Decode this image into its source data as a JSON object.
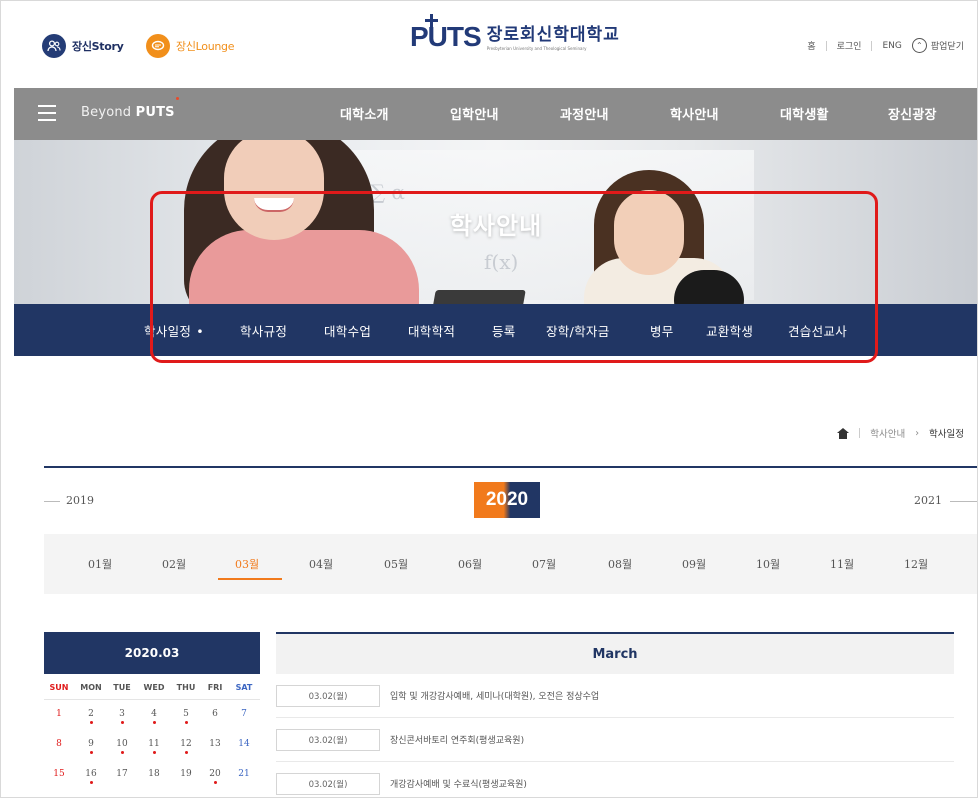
{
  "header": {
    "story_label": "장신Story",
    "lounge_label": "장신Lounge",
    "logo_mark": "PUTS",
    "logo_name": "장로회신학대학교",
    "logo_sub": "Presbyterian University and Theological Seminary",
    "util": {
      "home": "홈",
      "login": "로그인",
      "eng": "ENG",
      "popup_close": "팝업닫기"
    }
  },
  "gnb": {
    "beyond_prefix": "Beyond",
    "beyond_brand": "PUTS",
    "menus": [
      "대학소개",
      "입학안내",
      "과정안내",
      "학사안내",
      "대학생활",
      "장신광장"
    ]
  },
  "banner": {
    "title": "학사안내"
  },
  "lnb": {
    "items": [
      "학사일정",
      "학사규정",
      "대학수업",
      "대학학적",
      "등록",
      "장학/학자금",
      "병무",
      "교환학생",
      "견습선교사"
    ],
    "active_index": 0
  },
  "breadcrumb": {
    "parent": "학사안내",
    "current": "학사일정"
  },
  "years": {
    "prev": "2019",
    "current": "2020",
    "next": "2021"
  },
  "months": {
    "items": [
      "01월",
      "02월",
      "03월",
      "04월",
      "05월",
      "06월",
      "07월",
      "08월",
      "09월",
      "10월",
      "11월",
      "12월"
    ],
    "active_index": 2
  },
  "calendar": {
    "title": "2020.03",
    "weekdays": [
      "SUN",
      "MON",
      "TUE",
      "WED",
      "THU",
      "FRI",
      "SAT"
    ],
    "weeks": [
      [
        "1",
        "2",
        "3",
        "4",
        "5",
        "6",
        "7"
      ],
      [
        "8",
        "9",
        "10",
        "11",
        "12",
        "13",
        "14"
      ],
      [
        "15",
        "16",
        "17",
        "18",
        "19",
        "20",
        "21"
      ]
    ]
  },
  "schedule": {
    "month_title": "March",
    "events": [
      {
        "date": "03.02(월)",
        "title": "입학 및 개강감사예배, 세미나(대학원), 오전은 정상수업"
      },
      {
        "date": "03.02(월)",
        "title": "장신콘서바토리 연주회(평생교육원)"
      },
      {
        "date": "03.02(월)",
        "title": "개강감사예배 및 수료식(평생교육원)"
      }
    ]
  },
  "colors": {
    "navy": "#213664",
    "orange": "#f17a1c",
    "gnb_grey": "#8c8c8c",
    "highlight_red": "#e01a1a"
  }
}
